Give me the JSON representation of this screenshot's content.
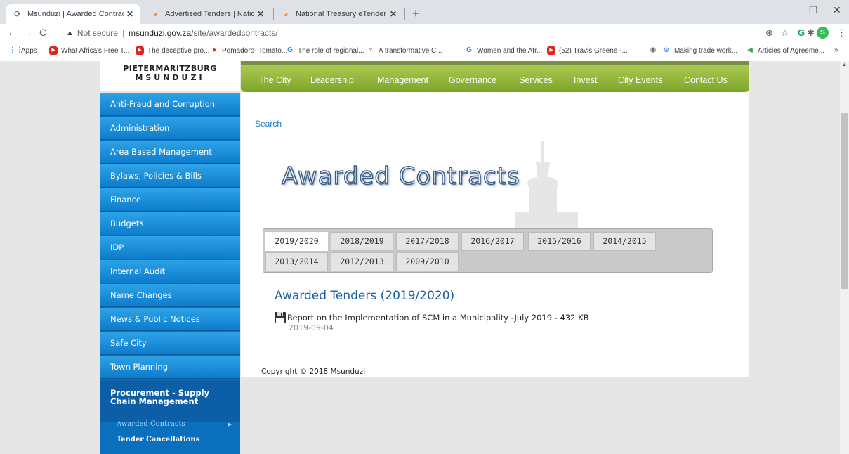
{
  "browser": {
    "tabs": [
      {
        "title": "Msunduzi | Awarded Contracts",
        "icon": "loading-spinner-icon"
      },
      {
        "title": "Advertised Tenders | National Tre",
        "icon": "treasury-favicon-icon"
      },
      {
        "title": "National Treasury eTender",
        "icon": "treasury-favicon-icon"
      }
    ],
    "new_tab": "+",
    "address": {
      "security_label": "Not secure",
      "host": "msunduzi.gov.za",
      "path": "/site/awardedcontracts/"
    },
    "profile_initial": "S",
    "bookmarks": [
      {
        "label": "Apps",
        "icon": "apps-grid-icon"
      },
      {
        "label": "What Africa's Free T...",
        "icon": "youtube-icon"
      },
      {
        "label": "The deceptive pro...",
        "icon": "youtube-icon"
      },
      {
        "label": "Pomadoro- Tomato...",
        "icon": "tomato-icon"
      },
      {
        "label": "The role of regional...",
        "icon": "google-icon"
      },
      {
        "label": "A transformative C...",
        "icon": "emblem-icon"
      },
      {
        "label": "Women and the Afr...",
        "icon": "google-icon"
      },
      {
        "label": "(52) Travis Greene -...",
        "icon": "youtube-icon"
      },
      {
        "label": "",
        "icon": "globe-icon"
      },
      {
        "label": "Making trade work...",
        "icon": "un-icon"
      },
      {
        "label": "Articles of Agreeme...",
        "icon": "bookmark-icon"
      }
    ]
  },
  "site": {
    "logo_line1": "PIETERMARITZBURG",
    "logo_line2": "MSUNDUZI",
    "nav": [
      "The City",
      "Leadership",
      "Management",
      "Governance",
      "Services",
      "Invest",
      "City Events",
      "Contact Us"
    ],
    "sidebar": [
      "Anti-Fraud and Corruption",
      "Administration",
      "Area Based Management",
      "Bylaws, Policies & Bills",
      "Finance",
      "Budgets",
      "IDP",
      "Internal Audit",
      "Name Changes",
      "News & Public Notices",
      "Safe City",
      "Town Planning"
    ],
    "sidebar_active": "Procurement - Supply Chain Management",
    "sidebar_sub": [
      "Awarded Contracts",
      "Tender Cancellations"
    ],
    "search_link": "Search",
    "page_title": "Awarded Contracts",
    "year_tabs_row1": [
      "2019/2020",
      "2018/2019",
      "2017/2018",
      "2016/2017",
      "2015/2016",
      "2014/2015"
    ],
    "year_tabs_row2": [
      "2013/2014",
      "2012/2013",
      "2009/2010"
    ],
    "selected_year": "2019/2020",
    "section_heading": "Awarded Tenders (2019/2020)",
    "documents": [
      {
        "title": "Report on the Implementation of SCM in a Municipality -July 2019",
        "size": " - 432 KB",
        "date": "2019-09-04"
      }
    ],
    "copyright": "Copyright © 2018 Msunduzi"
  }
}
